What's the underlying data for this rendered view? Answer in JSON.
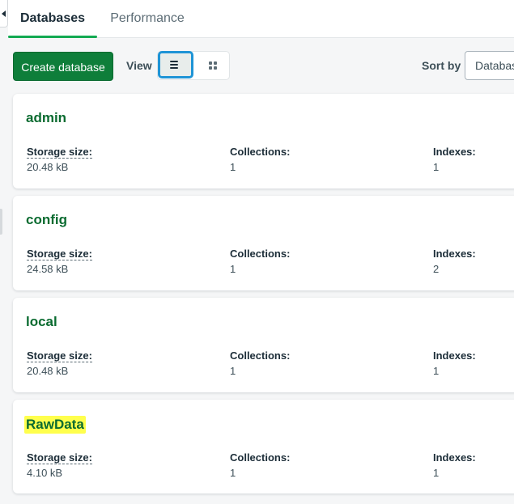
{
  "tabs": [
    {
      "label": "Databases",
      "active": true
    },
    {
      "label": "Performance",
      "active": false
    }
  ],
  "toolbar": {
    "create_label": "Create database",
    "view_label": "View",
    "view_mode": "list",
    "sort_label": "Sort by",
    "sort_value": "Database Name"
  },
  "databases": [
    {
      "name": "admin",
      "storage_label": "Storage size:",
      "storage": "20.48 kB",
      "collections_label": "Collections:",
      "collections": "1",
      "indexes_label": "Indexes:",
      "indexes": "1",
      "highlighted": false
    },
    {
      "name": "config",
      "storage_label": "Storage size:",
      "storage": "24.58 kB",
      "collections_label": "Collections:",
      "collections": "1",
      "indexes_label": "Indexes:",
      "indexes": "2",
      "highlighted": false
    },
    {
      "name": "local",
      "storage_label": "Storage size:",
      "storage": "20.48 kB",
      "collections_label": "Collections:",
      "collections": "1",
      "indexes_label": "Indexes:",
      "indexes": "1",
      "highlighted": false
    },
    {
      "name": "RawData",
      "storage_label": "Storage size:",
      "storage": "4.10 kB",
      "collections_label": "Collections:",
      "collections": "1",
      "indexes_label": "Indexes:",
      "indexes": "1",
      "highlighted": true
    }
  ],
  "colors": {
    "brand_green": "#0e7e3a",
    "tab_underline": "#13aa52",
    "focus_ring": "#1e94d6",
    "highlight": "#ffff4d"
  }
}
